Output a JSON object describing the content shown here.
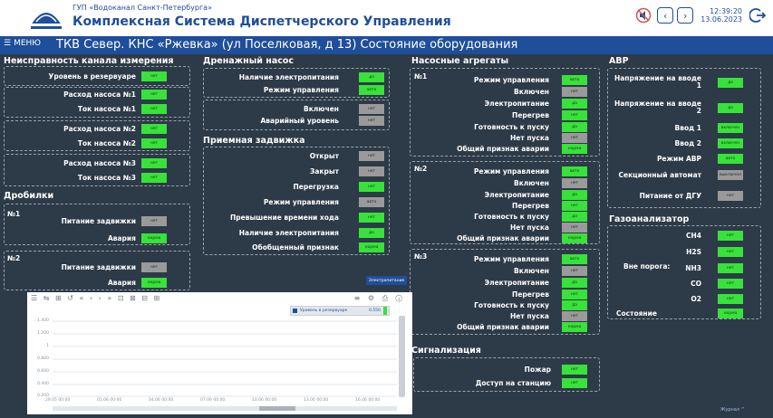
{
  "header": {
    "org": "ГУП «Водоканал Санкт-Петербурга»",
    "system": "Комплексная Система Диспетчерского Управления",
    "time": "12:39:20",
    "date": "13.06.2023"
  },
  "titlebar": {
    "menu": "МЕНЮ",
    "title": "ТКВ Север. КНС «Ржевка» (ул Поселковая, д 13) Состояние оборудования"
  },
  "sections": {
    "faults": "Неисправность канала измерения",
    "drain": "Дренажный насос",
    "pumps": "Насосные агрегаты",
    "avr": "АВР",
    "valve": "Приемная задвижка",
    "crushers": "Дробилки",
    "gas": "Газоанализатор",
    "signals": "Сигнализация"
  },
  "faults": {
    "rows": [
      {
        "label": "Уровень в резервуаре",
        "val": "нет"
      },
      {
        "label": "Расход насоса №1",
        "val": "нет"
      },
      {
        "label": "Ток насоса №1",
        "val": "нет"
      },
      {
        "label": "Расход насоса №2",
        "val": "нет"
      },
      {
        "label": "Ток насоса №2",
        "val": "нет"
      },
      {
        "label": "Расход насоса №3",
        "val": "нет"
      },
      {
        "label": "Ток насоса №3",
        "val": "нет"
      }
    ]
  },
  "crushers": {
    "n1": "№1",
    "n2": "№2",
    "rows": [
      {
        "label": "Питание задвижки",
        "val": "нет"
      },
      {
        "label": "Авария",
        "val": "норма"
      },
      {
        "label": "Питание задвижки",
        "val": "нет"
      },
      {
        "label": "Авария",
        "val": "норма"
      }
    ]
  },
  "drain": {
    "rows": [
      {
        "label": "Наличие электропитания",
        "val": "да"
      },
      {
        "label": "Режим управления",
        "val": "авто"
      },
      {
        "label": "Включен",
        "val": "нет"
      },
      {
        "label": "Аварийный уровень",
        "val": "нет"
      }
    ]
  },
  "valve": {
    "rows": [
      {
        "label": "Открыт",
        "val": "нет"
      },
      {
        "label": "Закрыт",
        "val": "нет"
      },
      {
        "label": "Перегрузка",
        "val": "нет"
      },
      {
        "label": "Режим управления",
        "val": "авто"
      },
      {
        "label": "Превышение времени хода",
        "val": "нет"
      },
      {
        "label": "Наличие электропитания",
        "val": "да"
      },
      {
        "label": "Обобщенный признак",
        "val": "норма"
      }
    ]
  },
  "pumps": {
    "n1": "№1",
    "n2": "№2",
    "n3": "№3",
    "rows": [
      {
        "label": "Режим управления",
        "val": "авто"
      },
      {
        "label": "Включен",
        "val": "нет"
      },
      {
        "label": "Электропитание",
        "val": "да"
      },
      {
        "label": "Перегрев",
        "val": "нет"
      },
      {
        "label": "Готовность к пуску",
        "val": "да"
      },
      {
        "label": "Нет пуска",
        "val": "нет"
      },
      {
        "label": "Общий признак аварии",
        "val": "норма"
      }
    ]
  },
  "avr": {
    "rows": [
      {
        "label": "Напряжение на вводе 1",
        "val": "да"
      },
      {
        "label": "Напряжение на вводе 2",
        "val": "да"
      },
      {
        "label": "Ввод 1",
        "val": "включен"
      },
      {
        "label": "Ввод 2",
        "val": "включен"
      },
      {
        "label": "Режим АВР",
        "val": "авто"
      },
      {
        "label": "Секционный автомат",
        "val": "выключен"
      },
      {
        "label": "Питание от ДГУ",
        "val": "нет"
      }
    ]
  },
  "gas": {
    "threshold": "Вне порога:",
    "state_label": "Состояние",
    "rows": [
      {
        "label": "CH4",
        "val": "нет"
      },
      {
        "label": "H2S",
        "val": "нет"
      },
      {
        "label": "NH3",
        "val": "нет"
      },
      {
        "label": "CO",
        "val": "нет"
      },
      {
        "label": "O2",
        "val": "нет"
      },
      {
        "label": "",
        "val": "норма"
      }
    ]
  },
  "signals": {
    "rows": [
      {
        "label": "Пожар",
        "val": "нет"
      },
      {
        "label": "Доступ на станцию",
        "val": "нет"
      }
    ]
  },
  "trend": {
    "button": "Электропитание",
    "legend": "Уровень в резервуаре",
    "legend_value": "0.550",
    "yticks": [
      "1.400",
      "1.200",
      "1",
      "0.800",
      "0.600",
      "0.400",
      "0.200"
    ],
    "xticks": [
      "29.05 00:00",
      "01.06 00:00",
      "04.06 00:00",
      "07.06 00:00",
      "10.06 00:00",
      "13.06 00:00",
      "16.06 00:00"
    ],
    "toolbar_left": "☰ ⇆ ⊞ ↺ « ‹ › » ⊡ ⊠ ⊟ ⊞",
    "toolbar_right": "≡ ⚙ ⎙ ⓘ"
  },
  "footer_note": "Журнал ^"
}
